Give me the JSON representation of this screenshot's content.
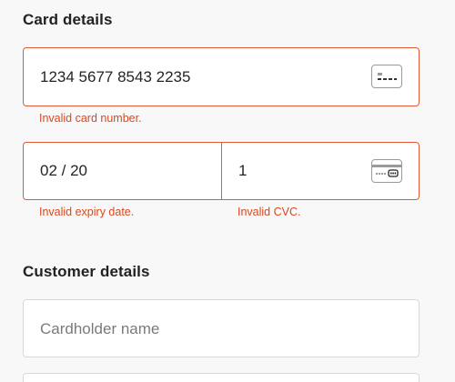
{
  "card_section": {
    "title": "Card details",
    "card_number": {
      "value": "1234 5677 8543 2235",
      "icon": "card-icon",
      "error": "Invalid card number."
    },
    "expiry": {
      "value": "02 / 20",
      "error": "Invalid expiry date."
    },
    "cvc": {
      "value": "1",
      "icon": "cvc-card-icon",
      "error": "Invalid CVC."
    }
  },
  "customer_section": {
    "title": "Customer details",
    "cardholder_name": {
      "placeholder": "Cardholder name",
      "value": ""
    }
  },
  "colors": {
    "error": "#df5a36",
    "error_text": "#d9481f",
    "background": "#f8f8f8"
  }
}
